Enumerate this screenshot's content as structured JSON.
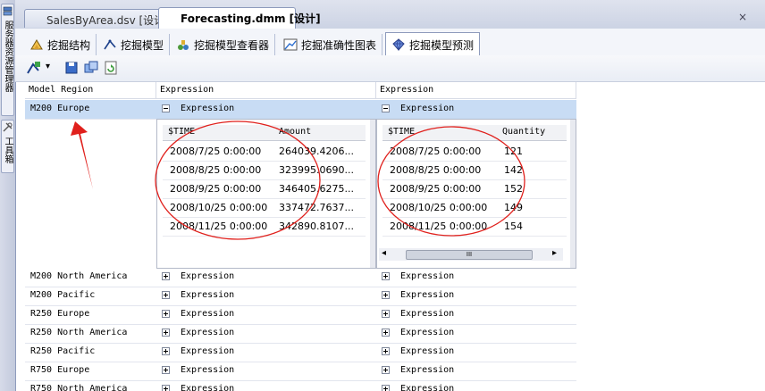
{
  "left_strip": {
    "tabs": [
      {
        "label": "服务器资源管理器",
        "icon": "server-explorer-icon"
      },
      {
        "label": "工具箱",
        "icon": "toolbox-icon"
      }
    ]
  },
  "document_tabs": [
    {
      "label": "SalesByArea.dsv [设计]",
      "active": false
    },
    {
      "label": "Forecasting.dmm [设计]",
      "active": true
    }
  ],
  "close_glyph": "×",
  "view_tabs": [
    {
      "label": "挖掘结构",
      "icon": "mining-structure-icon",
      "active": false
    },
    {
      "label": "挖掘模型",
      "icon": "mining-model-icon",
      "active": false
    },
    {
      "label": "挖掘模型查看器",
      "icon": "model-viewer-icon",
      "active": false
    },
    {
      "label": "挖掘准确性图表",
      "icon": "accuracy-chart-icon",
      "active": false
    },
    {
      "label": "挖掘模型预测",
      "icon": "model-prediction-icon",
      "active": true
    }
  ],
  "toolbar": {
    "dropdown_glyph": "▾",
    "buttons": [
      "mining-model-icon",
      "save-icon",
      "copy-icon",
      "refresh-icon"
    ]
  },
  "grid": {
    "columns": [
      "Model Region",
      "Expression",
      "Expression"
    ],
    "expression_label": "Expression",
    "selected_row": "M200 Europe",
    "other_rows": [
      "M200 North America",
      "M200 Pacific",
      "R250 Europe",
      "R250 North America",
      "R250 Pacific",
      "R750 Europe",
      "R750 North America"
    ],
    "amount_table": {
      "headers": [
        "$TIME",
        "Amount"
      ],
      "rows": [
        [
          "2008/7/25 0:00:00",
          "264039.4206..."
        ],
        [
          "2008/8/25 0:00:00",
          "323995.0690..."
        ],
        [
          "2008/9/25 0:00:00",
          "346405.6275..."
        ],
        [
          "2008/10/25 0:00:00",
          "337472.7637..."
        ],
        [
          "2008/11/25 0:00:00",
          "342890.8107..."
        ]
      ]
    },
    "quantity_table": {
      "headers": [
        "$TIME",
        "Quantity"
      ],
      "rows": [
        [
          "2008/7/25 0:00:00",
          "121"
        ],
        [
          "2008/8/25 0:00:00",
          "142"
        ],
        [
          "2008/9/25 0:00:00",
          "152"
        ],
        [
          "2008/10/25 0:00:00",
          "149"
        ],
        [
          "2008/11/25 0:00:00",
          "154"
        ]
      ]
    },
    "scroll_grip": "III",
    "scroll_left": "◂",
    "scroll_right": "▸"
  },
  "colors": {
    "selection": "#c8dcf4",
    "annotation": "#e0201c",
    "chrome": "#ccd3e4"
  }
}
